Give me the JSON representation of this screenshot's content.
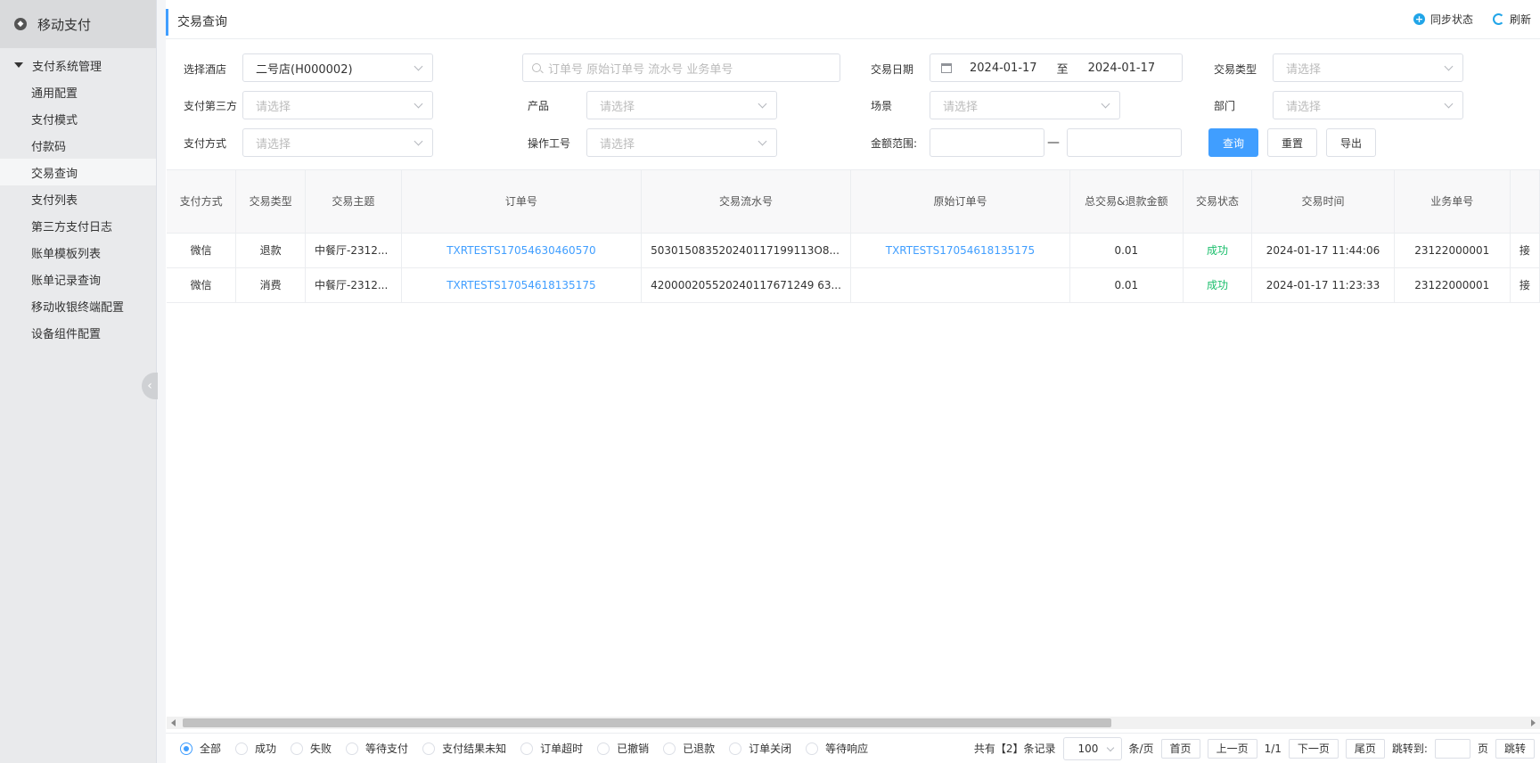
{
  "sidebar": {
    "app_title": "移动支付",
    "group": "支付系统管理",
    "items": [
      "通用配置",
      "支付模式",
      "付款码",
      "交易查询",
      "支付列表",
      "第三方支付日志",
      "账单模板列表",
      "账单记录查询",
      "移动收银终端配置",
      "设备组件配置"
    ]
  },
  "header": {
    "title": "交易查询",
    "sync_label": "同步状态",
    "refresh_label": "刷新"
  },
  "filters": {
    "hotel_label": "选择酒店",
    "hotel_value": "二号店(H000002)",
    "search_placeholder": "订单号 原始订单号 流水号 业务单号",
    "date_label": "交易日期",
    "date_start": "2024-01-17",
    "date_sep": "至",
    "date_end": "2024-01-17",
    "type_label": "交易类型",
    "third_label": "支付第三方",
    "product_label": "产品",
    "scene_label": "场景",
    "dept_label": "部门",
    "method_label": "支付方式",
    "operator_label": "操作工号",
    "amount_label": "金额范围:",
    "amount_sep": "—",
    "placeholder": "请选择",
    "query_btn": "查询",
    "reset_btn": "重置",
    "export_btn": "导出"
  },
  "table": {
    "columns": [
      "支付方式",
      "交易类型",
      "交易主题",
      "订单号",
      "交易流水号",
      "原始订单号",
      "总交易&退款金额",
      "交易状态",
      "交易时间",
      "业务单号",
      ""
    ],
    "rows": [
      [
        "微信",
        "退款",
        "中餐厅-2312...",
        "TXRTESTS17054630460570",
        "503015083520240117199113O8...",
        "TXRTESTS17054618135175",
        "0.01",
        "成功",
        "2024-01-17 11:44:06",
        "23122000001",
        "接"
      ],
      [
        "微信",
        "消费",
        "中餐厅-2312...",
        "TXRTESTS17054618135175",
        "420000205520240117671249 63...",
        "",
        "0.01",
        "成功",
        "2024-01-17 11:23:33",
        "23122000001",
        "接"
      ]
    ]
  },
  "footer": {
    "status_filters": [
      "全部",
      "成功",
      "失败",
      "等待支付",
      "支付结果未知",
      "订单超时",
      "已撤销",
      "已退款",
      "订单关闭",
      "等待响应"
    ],
    "total_text": "共有【2】条记录",
    "page_size": "100",
    "per_page": "条/页",
    "first": "首页",
    "prev": "上一页",
    "page_info": "1/1",
    "next": "下一页",
    "last": "尾页",
    "jump_label": "跳转到:",
    "page_unit": "页",
    "jump_btn": "跳转"
  },
  "colors": {
    "accent": "#409eff",
    "success": "#19be6b",
    "icon": "#21a5e8"
  }
}
